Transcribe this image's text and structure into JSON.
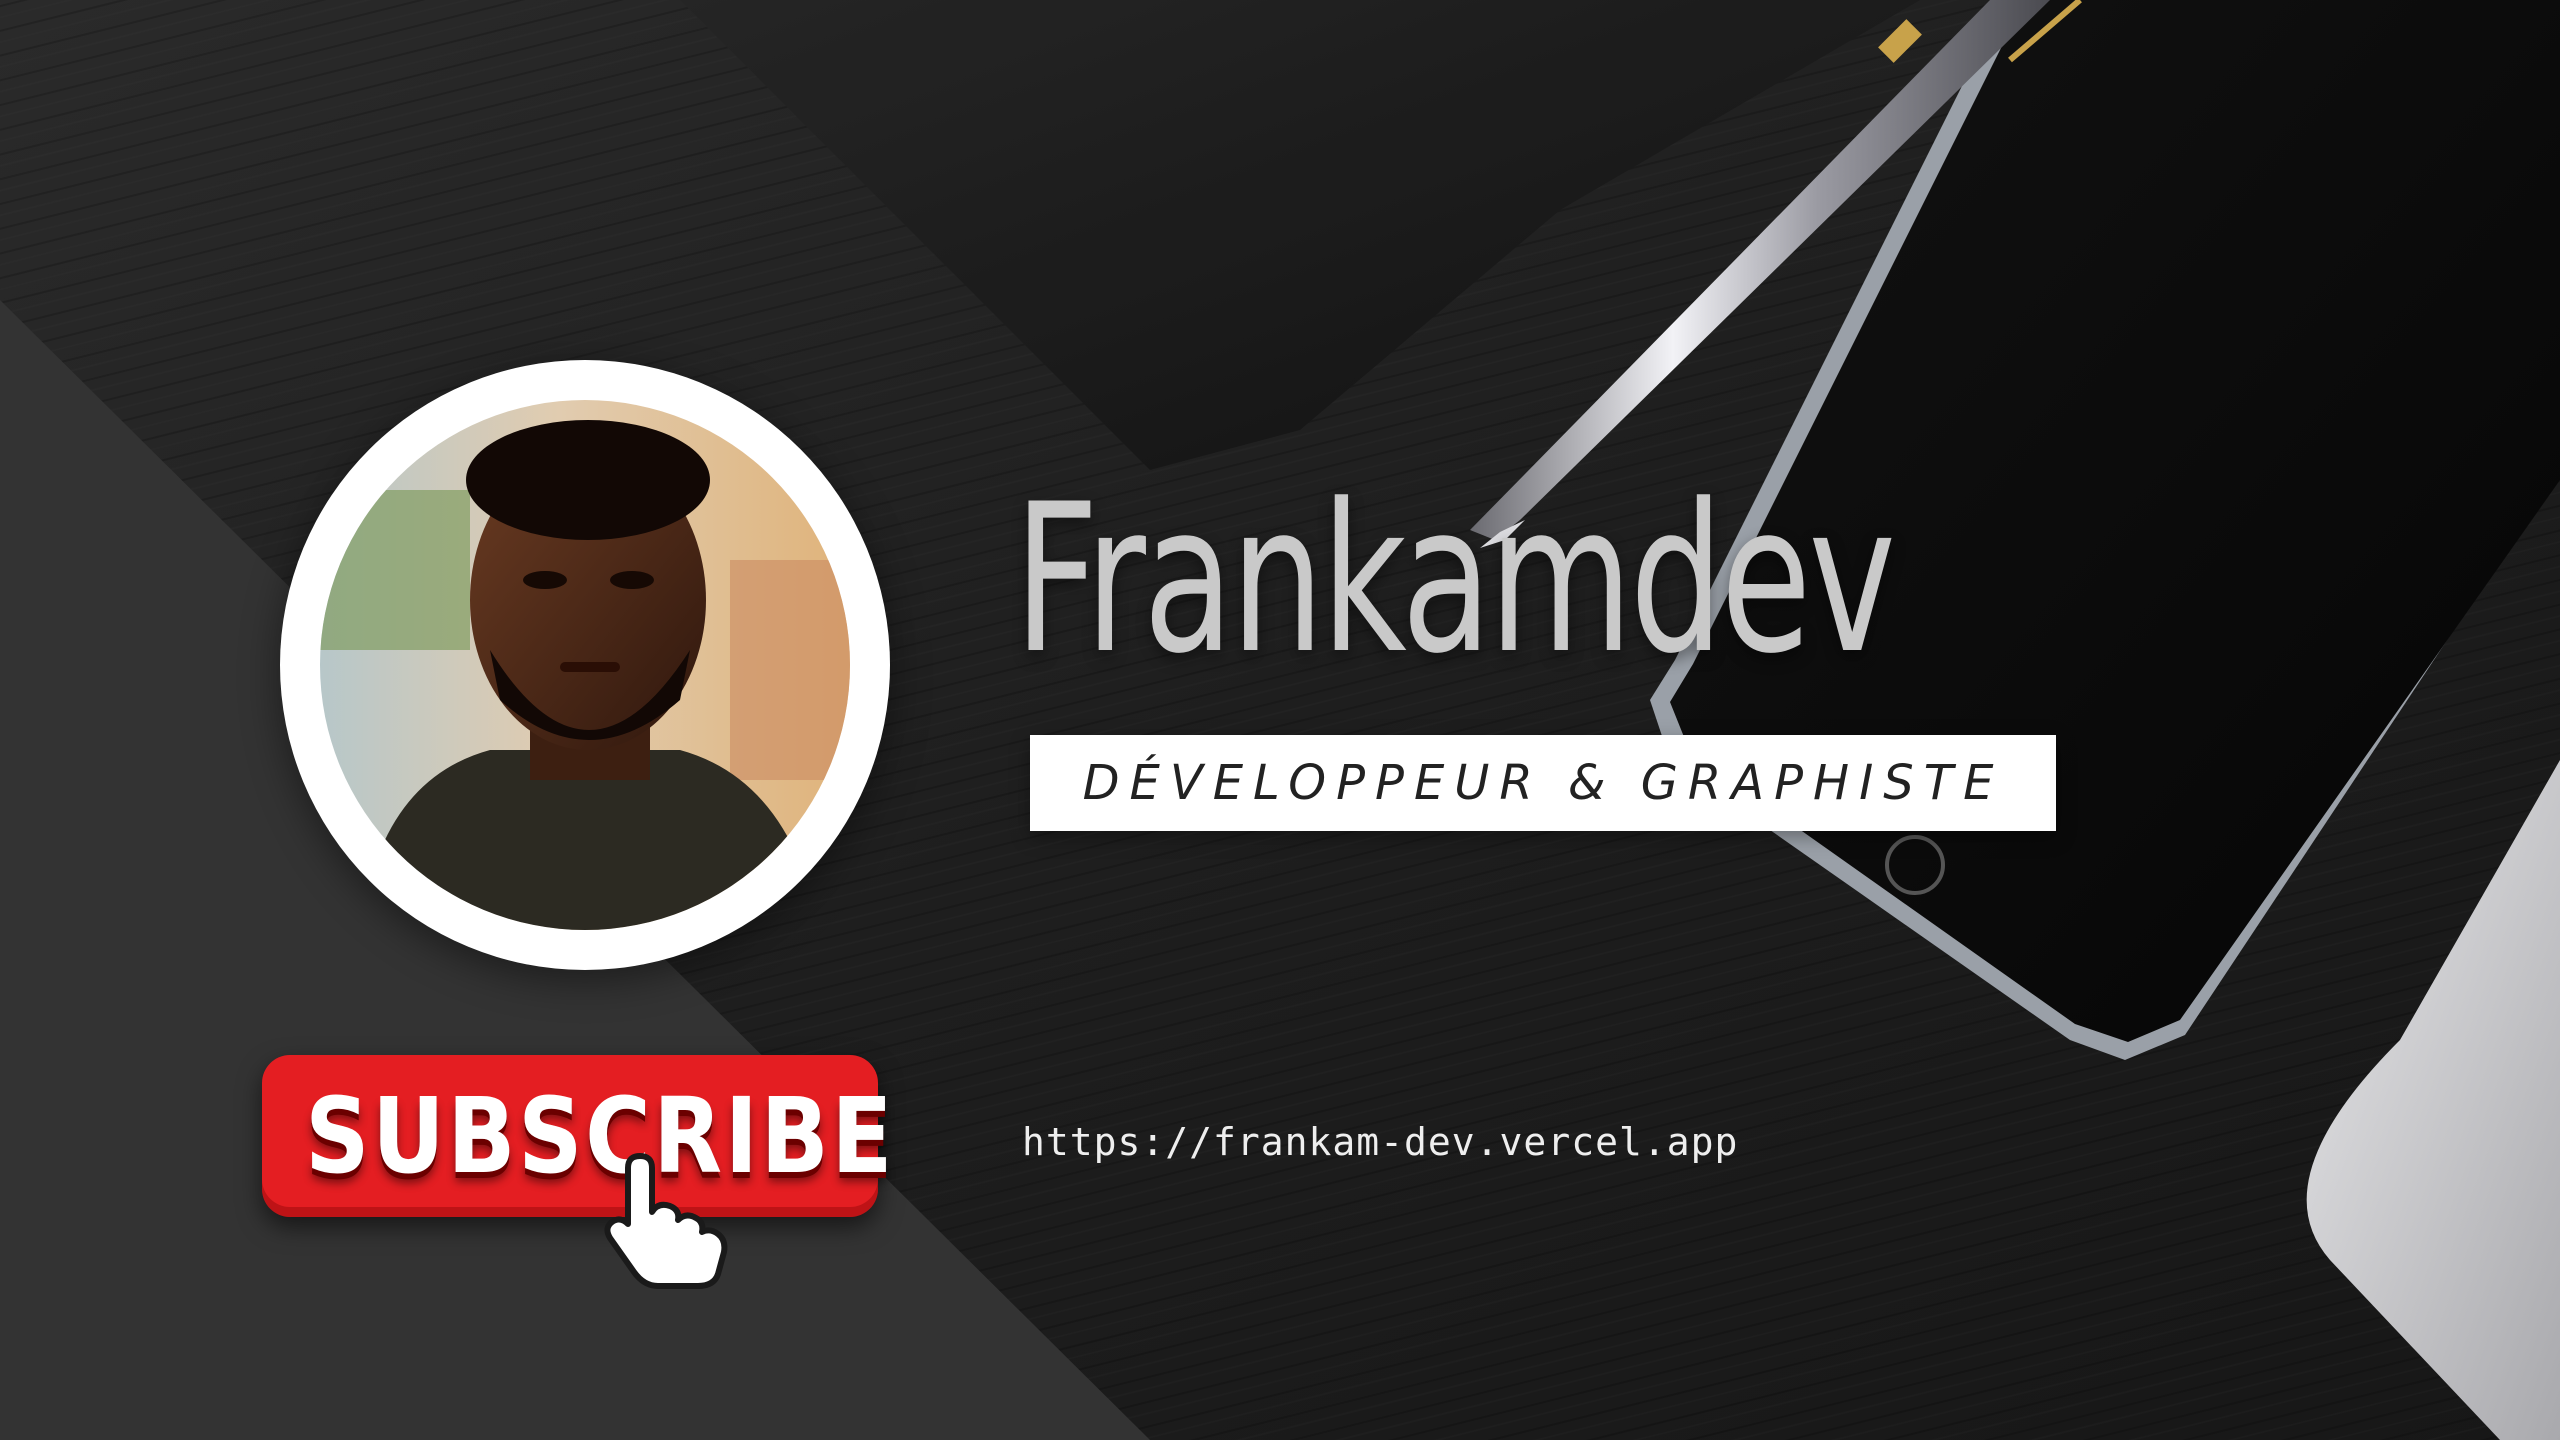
{
  "banner": {
    "name": "Frankamdev",
    "tagline": "DÉVELOPPEUR & GRAPHISTE",
    "website": "https://frankam-dev.vercel.app",
    "subscribe_label": "SUBSCRIBE"
  },
  "icons": {
    "cursor": "pointing-hand-icon",
    "profile": "profile-photo"
  },
  "colors": {
    "subscribe_red": "#e41e22",
    "name_gray": "#c9c9c9",
    "tagline_bg": "#ffffff",
    "panel_dark": "#333333"
  }
}
